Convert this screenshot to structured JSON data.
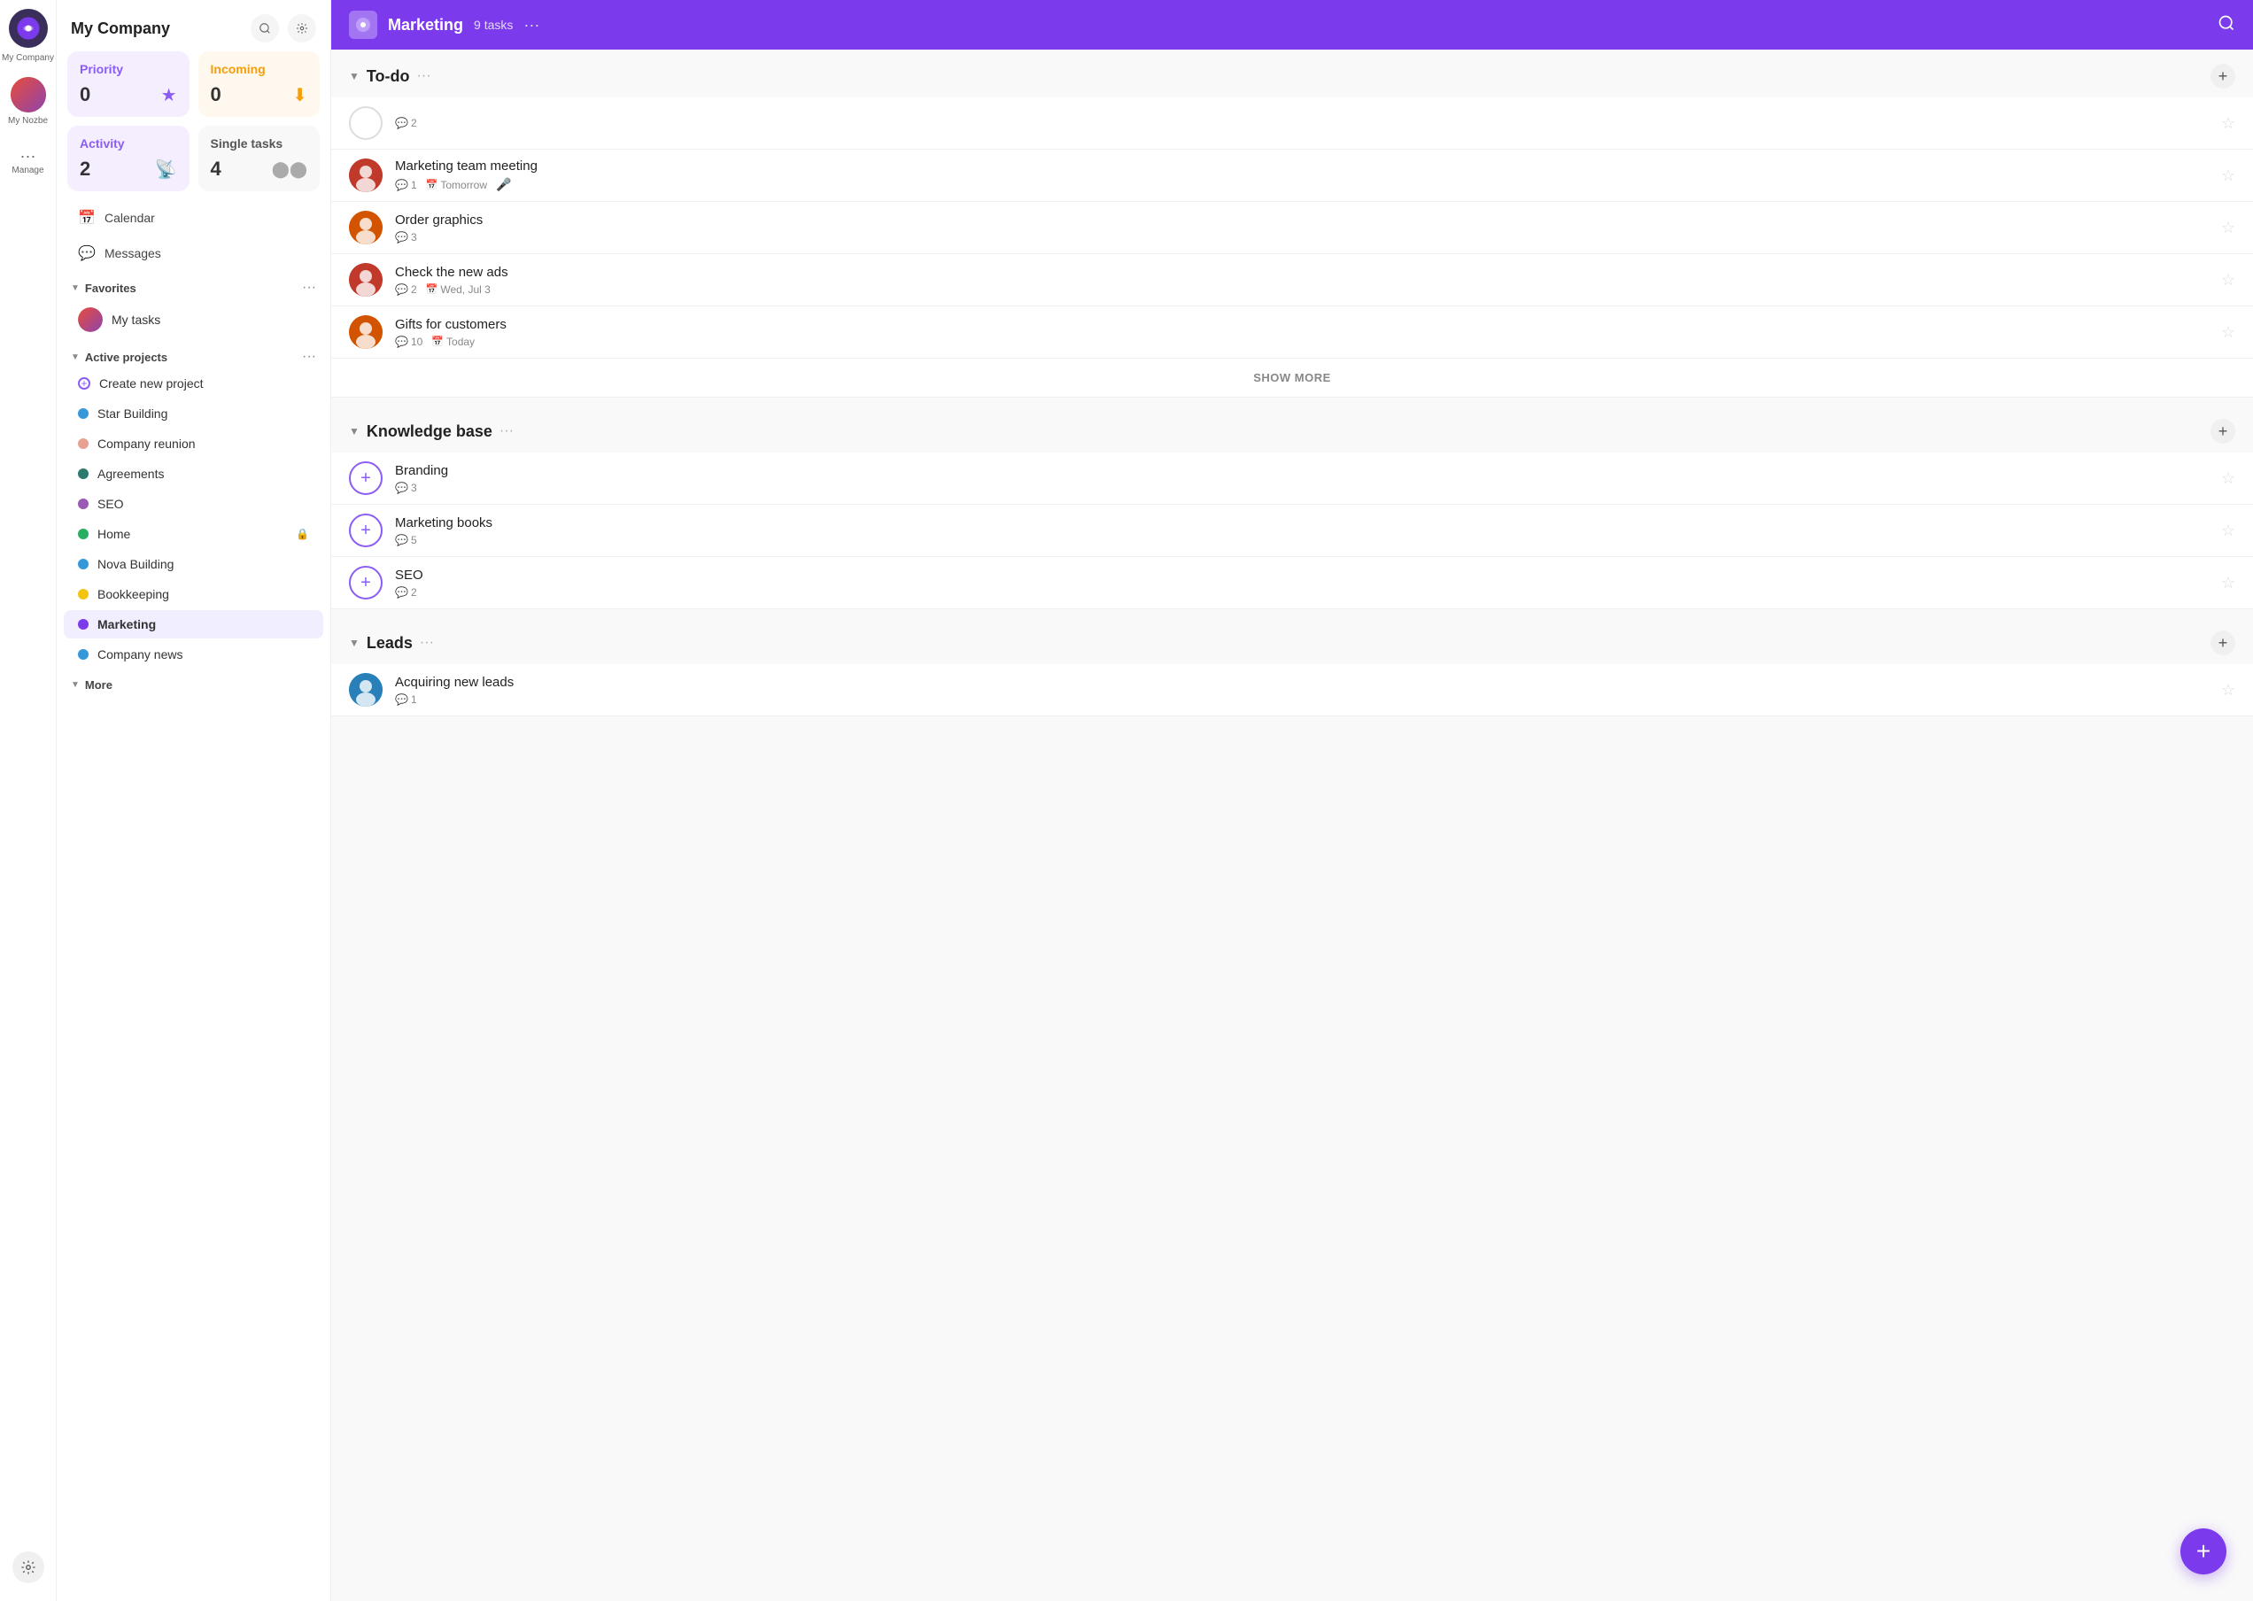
{
  "iconBar": {
    "appName": "My Company",
    "manageLabel": "Manage",
    "myNozbeLabel": "My Nozbe"
  },
  "sidebar": {
    "title": "My Company",
    "cards": [
      {
        "id": "priority",
        "label": "Priority",
        "count": "0",
        "type": "priority"
      },
      {
        "id": "incoming",
        "label": "Incoming",
        "count": "0",
        "type": "incoming"
      },
      {
        "id": "activity",
        "label": "Activity",
        "count": "2",
        "type": "activity"
      },
      {
        "id": "single",
        "label": "Single tasks",
        "count": "4",
        "type": "single"
      }
    ],
    "nav": [
      {
        "id": "calendar",
        "icon": "📅",
        "label": "Calendar"
      },
      {
        "id": "messages",
        "icon": "💬",
        "label": "Messages"
      }
    ],
    "favoritesLabel": "Favorites",
    "myTasksLabel": "My tasks",
    "activeProjectsLabel": "Active projects",
    "createProjectLabel": "Create new project",
    "projects": [
      {
        "id": "star-building",
        "label": "Star Building",
        "color": "#3498db",
        "active": false
      },
      {
        "id": "company-reunion",
        "label": "Company reunion",
        "color": "#e8a090",
        "active": false
      },
      {
        "id": "agreements",
        "label": "Agreements",
        "color": "#2c7a6e",
        "active": false
      },
      {
        "id": "seo",
        "label": "SEO",
        "color": "#9b59b6",
        "active": false
      },
      {
        "id": "home",
        "label": "Home",
        "color": "#27ae60",
        "active": false,
        "locked": true
      },
      {
        "id": "nova-building",
        "label": "Nova Building",
        "color": "#3498db",
        "active": false
      },
      {
        "id": "bookkeeping",
        "label": "Bookkeeping",
        "color": "#f1c40f",
        "active": false
      },
      {
        "id": "marketing",
        "label": "Marketing",
        "color": "#7c3aed",
        "active": true
      },
      {
        "id": "company-news",
        "label": "Company news",
        "color": "#3498db",
        "active": false
      }
    ],
    "moreLabel": "More"
  },
  "main": {
    "headerTitle": "Marketing",
    "headerCount": "9 tasks",
    "sections": [
      {
        "id": "todo",
        "title": "To-do",
        "tasks": [
          {
            "id": "t1",
            "avatarType": "empty",
            "title": "",
            "comments": "2",
            "date": "",
            "mic": false
          },
          {
            "id": "t2",
            "avatarType": "person1",
            "title": "Marketing team meeting",
            "comments": "1",
            "date": "Tomorrow",
            "mic": true
          },
          {
            "id": "t3",
            "avatarType": "person2",
            "title": "Order graphics",
            "comments": "3",
            "date": "",
            "mic": false
          },
          {
            "id": "t4",
            "avatarType": "person1",
            "title": "Check the new ads",
            "comments": "2",
            "date": "Wed, Jul 3",
            "mic": false
          },
          {
            "id": "t5",
            "avatarType": "person2",
            "title": "Gifts for customers",
            "comments": "10",
            "date": "Today",
            "mic": false
          }
        ],
        "showMore": true,
        "showMoreLabel": "SHOW MORE"
      },
      {
        "id": "knowledge-base",
        "title": "Knowledge base",
        "tasks": [
          {
            "id": "kb1",
            "avatarType": "plus",
            "title": "Branding",
            "comments": "3",
            "date": "",
            "mic": false
          },
          {
            "id": "kb2",
            "avatarType": "plus",
            "title": "Marketing books",
            "comments": "5",
            "date": "",
            "mic": false
          },
          {
            "id": "kb3",
            "avatarType": "plus",
            "title": "SEO",
            "comments": "2",
            "date": "",
            "mic": false
          }
        ],
        "showMore": false
      },
      {
        "id": "leads",
        "title": "Leads",
        "tasks": [
          {
            "id": "l1",
            "avatarType": "person3",
            "title": "Acquiring new leads",
            "comments": "1",
            "date": "",
            "mic": false
          }
        ],
        "showMore": false
      }
    ]
  }
}
